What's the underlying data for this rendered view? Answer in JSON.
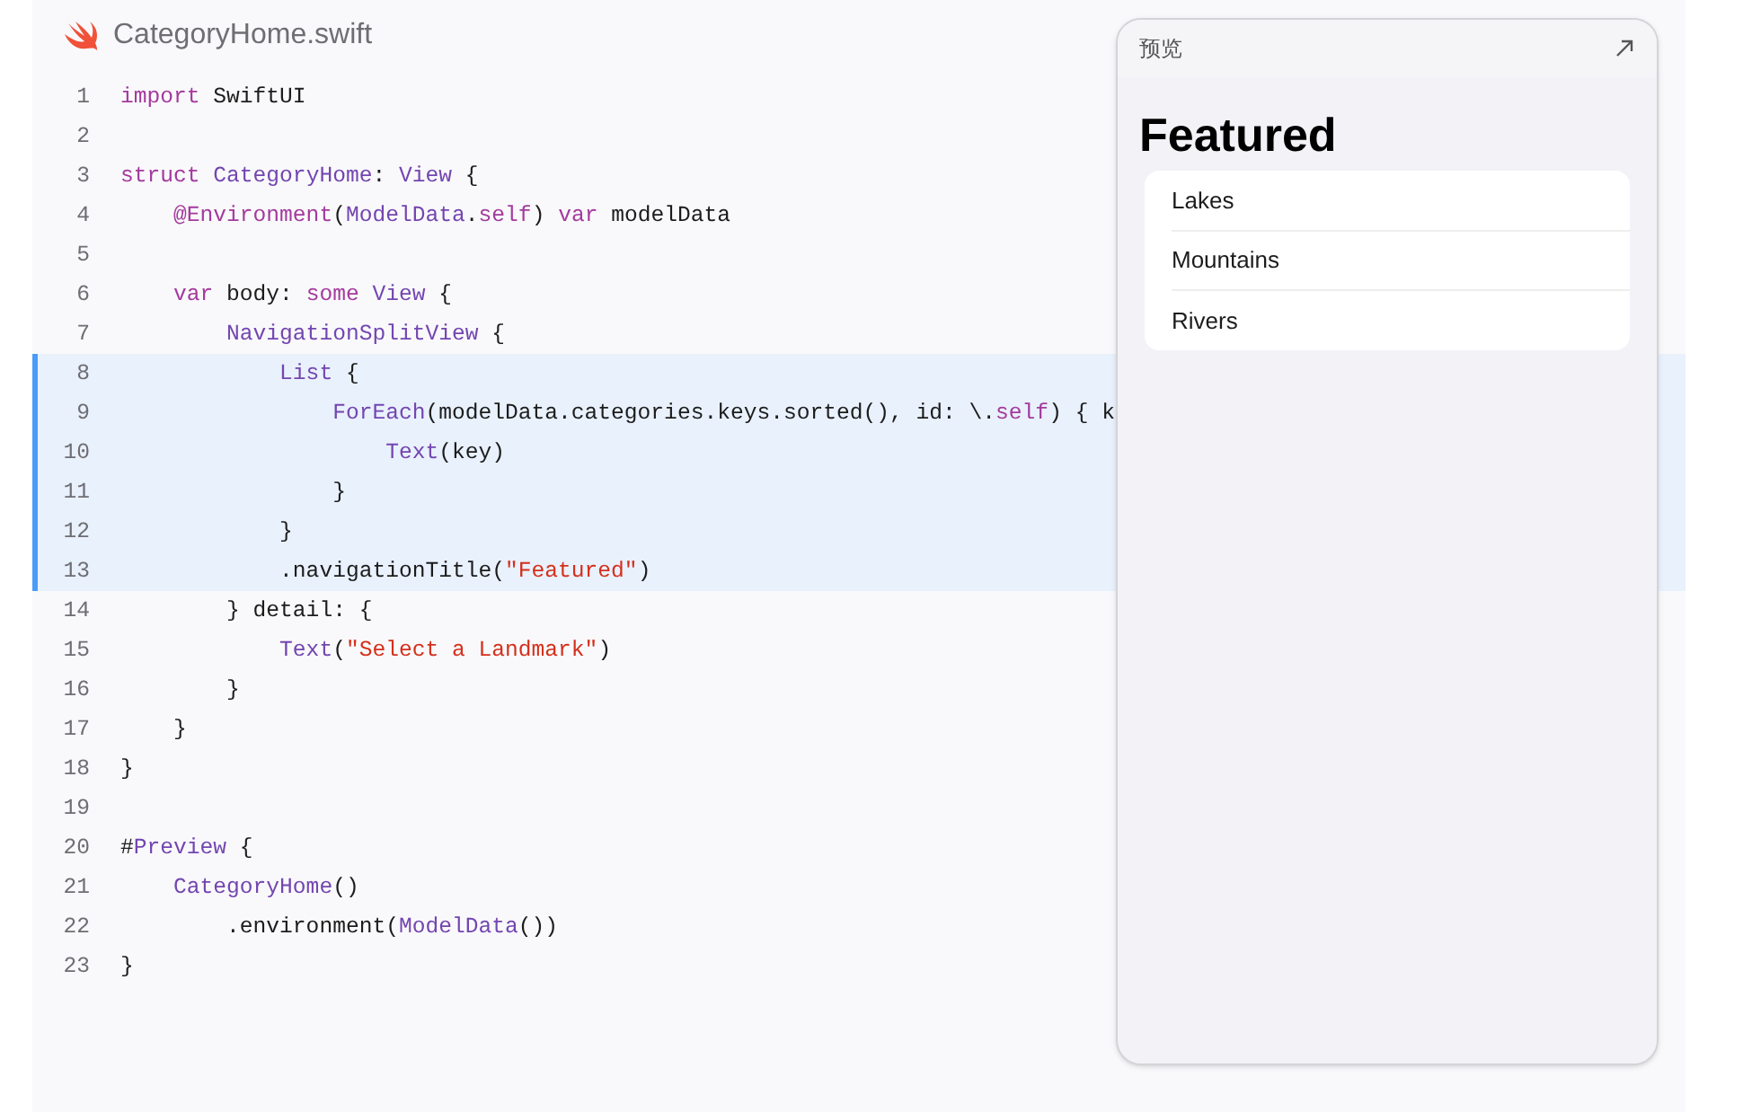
{
  "file": {
    "name": "CategoryHome.swift"
  },
  "code_lines": [
    {
      "number": "1",
      "highlighted": false,
      "tokens": [
        {
          "kind": "keyword",
          "text": "import"
        },
        {
          "kind": "plain",
          "text": " SwiftUI"
        }
      ]
    },
    {
      "number": "2",
      "highlighted": false
    },
    {
      "number": "3",
      "highlighted": false,
      "tokens": [
        {
          "kind": "keyword",
          "text": "struct"
        },
        {
          "kind": "type",
          "text": " CategoryHome"
        },
        {
          "kind": "plain",
          "text": ": "
        },
        {
          "kind": "type",
          "text": "View"
        },
        {
          "kind": "plain",
          "text": " {"
        }
      ]
    },
    {
      "number": "4",
      "highlighted": false,
      "tokens": [
        {
          "kind": "keyword",
          "text": "    @Environment"
        },
        {
          "kind": "plain",
          "text": "("
        },
        {
          "kind": "type",
          "text": "ModelData"
        },
        {
          "kind": "plain",
          "text": "."
        },
        {
          "kind": "keyword",
          "text": "self"
        },
        {
          "kind": "plain",
          "text": ") "
        },
        {
          "kind": "keyword",
          "text": "var"
        },
        {
          "kind": "plain",
          "text": " modelData"
        }
      ]
    },
    {
      "number": "5",
      "highlighted": false
    },
    {
      "number": "6",
      "highlighted": false,
      "tokens": [
        {
          "kind": "keyword",
          "text": "    var"
        },
        {
          "kind": "plain",
          "text": " body: "
        },
        {
          "kind": "keyword",
          "text": "some"
        },
        {
          "kind": "type",
          "text": " View"
        },
        {
          "kind": "plain",
          "text": " {"
        }
      ]
    },
    {
      "number": "7",
      "highlighted": false,
      "tokens": [
        {
          "kind": "type",
          "text": "        NavigationSplitView"
        },
        {
          "kind": "plain",
          "text": " {"
        }
      ]
    },
    {
      "number": "8",
      "highlighted": true,
      "tokens": [
        {
          "kind": "type",
          "text": "            List"
        },
        {
          "kind": "plain",
          "text": " {"
        }
      ]
    },
    {
      "number": "9",
      "highlighted": true,
      "tokens": [
        {
          "kind": "type",
          "text": "                ForEach"
        },
        {
          "kind": "plain",
          "text": "(modelData.categories.keys.sorted(), id: \\."
        },
        {
          "kind": "keyword",
          "text": "self"
        },
        {
          "kind": "plain",
          "text": ") { k"
        }
      ]
    },
    {
      "number": "10",
      "highlighted": true,
      "tokens": [
        {
          "kind": "type",
          "text": "                    Text"
        },
        {
          "kind": "plain",
          "text": "(key)"
        }
      ]
    },
    {
      "number": "11",
      "highlighted": true,
      "tokens": [
        {
          "kind": "plain",
          "text": "                }"
        }
      ]
    },
    {
      "number": "12",
      "highlighted": true,
      "tokens": [
        {
          "kind": "plain",
          "text": "            }"
        }
      ]
    },
    {
      "number": "13",
      "highlighted": true,
      "tokens": [
        {
          "kind": "plain",
          "text": "            .navigationTitle("
        },
        {
          "kind": "string",
          "text": "\"Featured\""
        },
        {
          "kind": "plain",
          "text": ")"
        }
      ]
    },
    {
      "number": "14",
      "highlighted": false,
      "tokens": [
        {
          "kind": "plain",
          "text": "        } detail: {"
        }
      ]
    },
    {
      "number": "15",
      "highlighted": false,
      "tokens": [
        {
          "kind": "type",
          "text": "            Text"
        },
        {
          "kind": "plain",
          "text": "("
        },
        {
          "kind": "string",
          "text": "\"Select a Landmark\""
        },
        {
          "kind": "plain",
          "text": ")"
        }
      ]
    },
    {
      "number": "16",
      "highlighted": false,
      "tokens": [
        {
          "kind": "plain",
          "text": "        }"
        }
      ]
    },
    {
      "number": "17",
      "highlighted": false,
      "tokens": [
        {
          "kind": "plain",
          "text": "    }"
        }
      ]
    },
    {
      "number": "18",
      "highlighted": false,
      "tokens": [
        {
          "kind": "plain",
          "text": "}"
        }
      ]
    },
    {
      "number": "19",
      "highlighted": false
    },
    {
      "number": "20",
      "highlighted": false,
      "tokens": [
        {
          "kind": "plain",
          "text": "#"
        },
        {
          "kind": "type",
          "text": "Preview"
        },
        {
          "kind": "plain",
          "text": " {"
        }
      ]
    },
    {
      "number": "21",
      "highlighted": false,
      "tokens": [
        {
          "kind": "type",
          "text": "    CategoryHome"
        },
        {
          "kind": "plain",
          "text": "()"
        }
      ]
    },
    {
      "number": "22",
      "highlighted": false,
      "tokens": [
        {
          "kind": "plain",
          "text": "        .environment("
        },
        {
          "kind": "type",
          "text": "ModelData"
        },
        {
          "kind": "plain",
          "text": "())"
        }
      ]
    },
    {
      "number": "23",
      "highlighted": false,
      "tokens": [
        {
          "kind": "plain",
          "text": "}"
        }
      ]
    }
  ],
  "preview": {
    "title": "预览",
    "navigation_title": "Featured",
    "list_items": [
      "Lakes",
      "Mountains",
      "Rivers"
    ]
  }
}
